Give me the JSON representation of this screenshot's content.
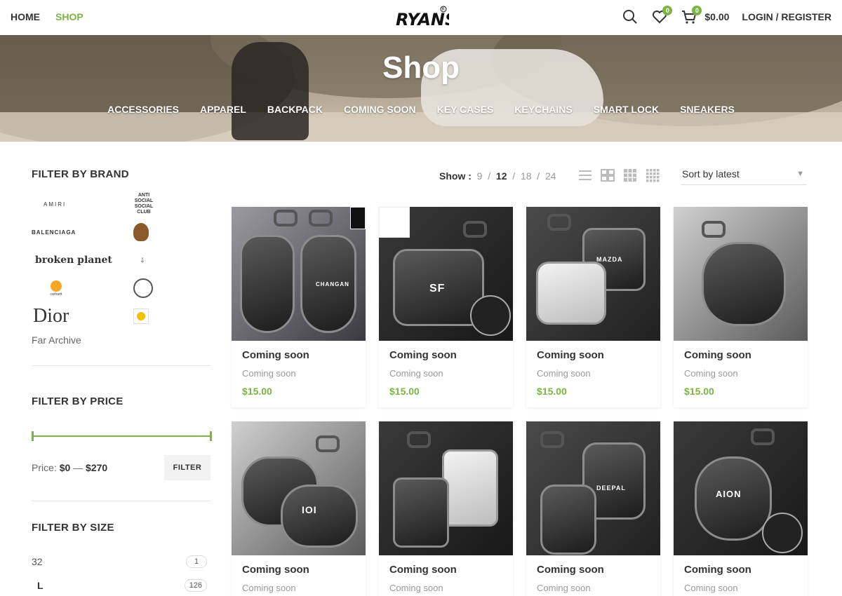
{
  "header": {
    "nav": [
      {
        "label": "HOME",
        "active": false
      },
      {
        "label": "SHOP",
        "active": true
      }
    ],
    "logo_text": "RYANS",
    "wishlist_count": "0",
    "cart_count": "0",
    "cart_total": "$0.00",
    "login_label": "LOGIN / REGISTER"
  },
  "hero": {
    "title": "Shop",
    "categories": [
      "ACCESSORIES",
      "APPAREL",
      "BACKPACK",
      "COMING SOON",
      "KEY CASES",
      "KEYCHAINS",
      "SMART LOCK",
      "SNEAKERS"
    ]
  },
  "sidebar": {
    "brand_title": "FILTER BY BRAND",
    "brands": [
      "AMIRI",
      "ANTI SOCIAL SOCIAL CLUB",
      "BALENCIAGA",
      "BAPE",
      "broken planet",
      "Travis Scott",
      "carhartt",
      "Chrome Hearts",
      "Dior",
      "Smiley"
    ],
    "brand_texts": {
      "amiri": "AMIRI",
      "assc": "ANTI SOCIAL SOCIAL CLUB",
      "balenciaga": "BALENCIAGA",
      "broken": "broken planet",
      "carhartt": "carhartt",
      "dior": "Dior"
    },
    "far_archive": "Far Archive",
    "price_title": "FILTER BY PRICE",
    "price_label": "Price:",
    "price_min": "$0",
    "price_sep": "—",
    "price_max": "$270",
    "filter_label": "FILTER",
    "size_title": "FILTER BY SIZE",
    "sizes": [
      {
        "label": "32",
        "count": "1"
      },
      {
        "label": "L",
        "count": "126"
      }
    ]
  },
  "toolbar": {
    "show_label": "Show :",
    "show_options": [
      "9",
      "12",
      "18",
      "24"
    ],
    "show_selected": "12",
    "sort_label": "Sort by latest"
  },
  "products": [
    {
      "title": "Coming soon",
      "category": "Coming soon",
      "price": "$15.00"
    },
    {
      "title": "Coming soon",
      "category": "Coming soon",
      "price": "$15.00"
    },
    {
      "title": "Coming soon",
      "category": "Coming soon",
      "price": "$15.00"
    },
    {
      "title": "Coming soon",
      "category": "Coming soon",
      "price": "$15.00"
    },
    {
      "title": "Coming soon",
      "category": "Coming soon",
      "price": ""
    },
    {
      "title": "Coming soon",
      "category": "Coming soon",
      "price": ""
    },
    {
      "title": "Coming soon",
      "category": "Coming soon",
      "price": ""
    },
    {
      "title": "Coming soon",
      "category": "Coming soon",
      "price": ""
    }
  ],
  "product_emblems": [
    "CHANGAN",
    "SF",
    "MAZDA",
    "",
    "IOI",
    "",
    "DEEPAL",
    "AION"
  ],
  "colors": {
    "accent": "#7cb342",
    "text": "#333333"
  }
}
